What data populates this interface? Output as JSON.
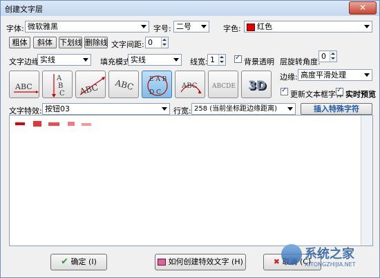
{
  "window": {
    "title": "创建文字层",
    "close": "✕"
  },
  "font": {
    "label": "字体:",
    "value": "微软雅黑"
  },
  "size": {
    "label": "字号:",
    "value": "二号"
  },
  "color": {
    "label": "字色:",
    "value": "红色",
    "swatch": "#e00000"
  },
  "style_buttons": [
    "粗体",
    "斜体",
    "下划线",
    "删除线"
  ],
  "spacing": {
    "label": "文字间距:",
    "value": "0"
  },
  "border": {
    "label": "文字边缘:",
    "value": "实线"
  },
  "fill": {
    "label": "填充模式:",
    "value": "实线"
  },
  "width": {
    "label": "线宽:",
    "value": "1"
  },
  "bg_transparent": {
    "label": "背景透明",
    "checked": true
  },
  "rotation": {
    "label": "层旋转角度:",
    "value": "0"
  },
  "edge": {
    "label": "边缘:",
    "value": "高度平滑处理"
  },
  "effects": [
    "flat",
    "vertical",
    "arc-up",
    "arc-down",
    "circle",
    "arc",
    "wave",
    "3d"
  ],
  "update_frame": {
    "label": "更新文本框字体",
    "checked": true
  },
  "live_preview": {
    "label": "实时预览",
    "checked": true
  },
  "special": {
    "label": "文字特效:",
    "value": "按钮03"
  },
  "line_width": {
    "label": "行宽:",
    "value": "258 (当前坐标距边缘距离)"
  },
  "insert_button": "插入特殊字符",
  "ok_button": "确定 (I)",
  "help_button": "如何创建特效文字 (H)",
  "cancel_button": "取消 (C)",
  "watermark": {
    "main": "系统之家",
    "sub": "XITONGZHIJIA.NET"
  },
  "colors": {
    "accent": "#1e5aa8",
    "text_red": "#e00000"
  }
}
